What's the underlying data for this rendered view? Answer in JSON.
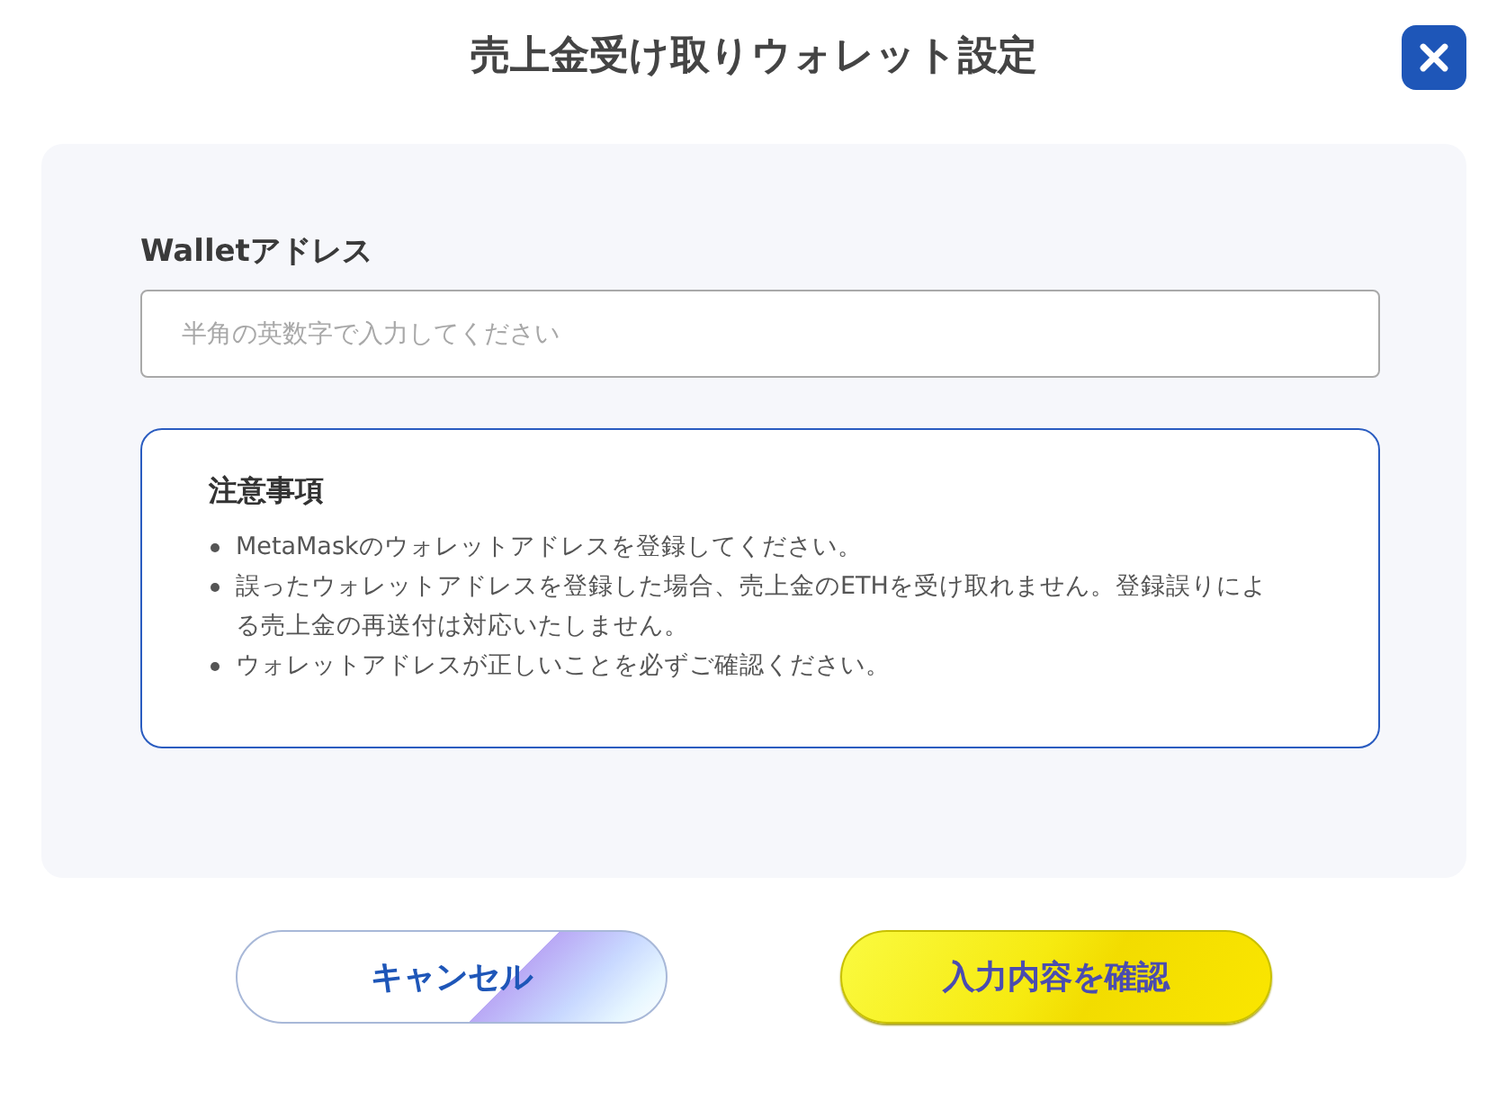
{
  "dialog": {
    "title": "売上金受け取りウォレット設定"
  },
  "wallet_field": {
    "label": "Walletアドレス",
    "placeholder": "半角の英数字で入力してください"
  },
  "notice": {
    "title": "注意事項",
    "items": [
      "MetaMaskのウォレットアドレスを登録してください。",
      "誤ったウォレットアドレスを登録した場合、売上金のETHを受け取れません。登録誤りによる売上金の再送付は対応いたしません。",
      "ウォレットアドレスが正しいことを必ずご確認ください。"
    ]
  },
  "buttons": [
    {
      "label": "キャンセル",
      "kind": "secondary"
    },
    {
      "label": "入力内容を確認",
      "kind": "primary"
    }
  ]
}
